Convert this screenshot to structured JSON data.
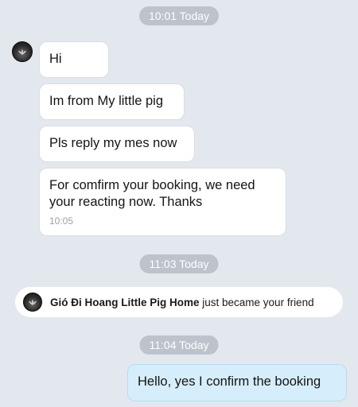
{
  "timestamps": {
    "first": "10:01 Today",
    "second": "11:03 Today",
    "third": "11:04 Today"
  },
  "incoming_messages": [
    {
      "text": "Hi"
    },
    {
      "text": "Im from My little pig"
    },
    {
      "text": "Pls reply my mes now"
    },
    {
      "text_line1": "For comfirm your booking, we need",
      "text_line2": "your reacting now. Thanks",
      "time": "10:05"
    }
  ],
  "friend_notice": {
    "name": "Gió Đi Hoang Little Pig Home",
    "action": " just became your friend"
  },
  "outgoing_messages": [
    {
      "text": "Hello, yes I confirm the booking"
    }
  ],
  "colors": {
    "background": "#e3e8ee",
    "incoming_bubble": "#ffffff",
    "outgoing_bubble": "#d6eefb",
    "timestamp_pill": "#bcc3cb"
  },
  "icons": {
    "sender_avatar": "lotus-logo-avatar"
  }
}
